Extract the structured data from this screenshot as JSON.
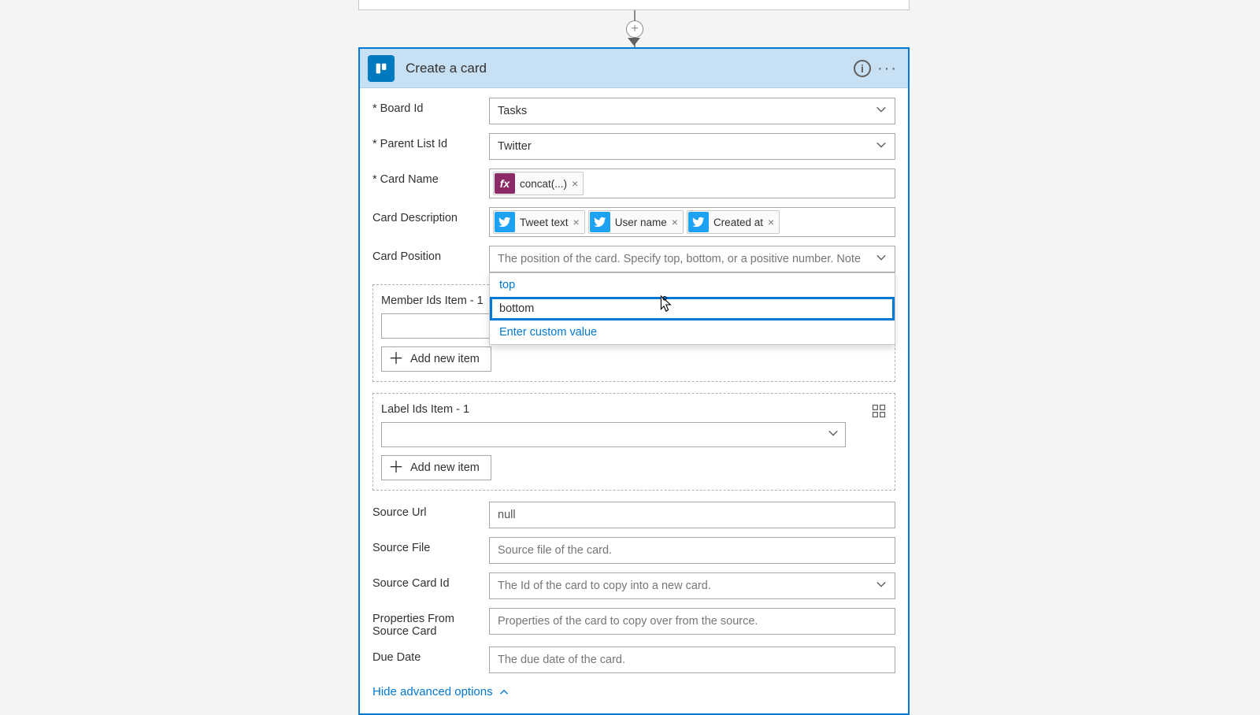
{
  "header": {
    "title": "Create a card"
  },
  "fields": {
    "board_id": {
      "label": "Board Id",
      "value": "Tasks"
    },
    "parent_list": {
      "label": "Parent List Id",
      "value": "Twitter"
    },
    "card_name": {
      "label": "Card Name",
      "tokens": [
        {
          "kind": "fx",
          "label": "concat(...)"
        }
      ]
    },
    "card_desc": {
      "label": "Card Description",
      "tokens": [
        {
          "kind": "tw",
          "label": "Tweet text"
        },
        {
          "kind": "tw",
          "label": "User name"
        },
        {
          "kind": "tw",
          "label": "Created at"
        }
      ]
    },
    "card_position": {
      "label": "Card Position",
      "placeholder": "The position of the card. Specify top, bottom, or a positive number. Note",
      "options": [
        "top",
        "bottom",
        "Enter custom value"
      ],
      "highlighted": "bottom"
    },
    "member_ids": {
      "label": "Member Ids Item - 1"
    },
    "label_ids": {
      "label": "Label Ids Item - 1"
    },
    "source_url": {
      "label": "Source Url",
      "value": "null"
    },
    "source_file": {
      "label": "Source File",
      "placeholder": "Source file of the card."
    },
    "source_card_id": {
      "label": "Source Card Id",
      "placeholder": "The Id of the card to copy into a new card."
    },
    "props_from_source": {
      "label": "Properties From Source Card",
      "placeholder": "Properties of the card to copy over from the source."
    },
    "due_date": {
      "label": "Due Date",
      "placeholder": "The due date of the card."
    }
  },
  "buttons": {
    "add_new_item": "Add new item",
    "hide_advanced": "Hide advanced options"
  }
}
